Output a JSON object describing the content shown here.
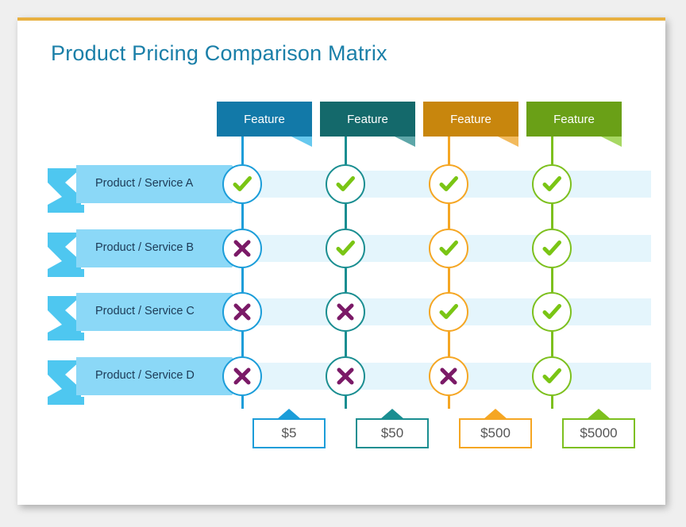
{
  "page": {
    "title": "Product Pricing Comparison Matrix",
    "accent_bar_color": "#e8b040",
    "card_background": "#ffffff",
    "canvas_background": "#efefef",
    "title_color": "#1a7fa8"
  },
  "palette": {
    "check_color": "#7ac514",
    "cross_color": "#7b1a67",
    "row_stripe": "#e4f5fc",
    "ribbon_body": "#8bd8f7",
    "ribbon_fold": "#4ec7f0",
    "ribbon_text": "#1c3a56",
    "price_text": "#555555"
  },
  "columns": [
    {
      "header": "Feature",
      "price": "$5",
      "header_color": "#1279a8",
      "accent_color": "#1b9dd9",
      "tail_color": "#2bb3e8"
    },
    {
      "header": "Feature",
      "price": "$50",
      "header_color": "#14696b",
      "accent_color": "#1a8e91",
      "tail_color": "#1f8487"
    },
    {
      "header": "Feature",
      "price": "$500",
      "header_color": "#c8860d",
      "accent_color": "#f5a623",
      "tail_color": "#eda01f"
    },
    {
      "header": "Feature",
      "price": "$5000",
      "header_color": "#6aa017",
      "accent_color": "#7dc01e",
      "tail_color": "#85c927"
    }
  ],
  "rows": [
    {
      "label": "Product / Service A",
      "values": [
        "check",
        "check",
        "check",
        "check"
      ]
    },
    {
      "label": "Product / Service B",
      "values": [
        "cross",
        "check",
        "check",
        "check"
      ]
    },
    {
      "label": "Product / Service C",
      "values": [
        "cross",
        "cross",
        "check",
        "check"
      ]
    },
    {
      "label": "Product / Service D",
      "values": [
        "cross",
        "cross",
        "cross",
        "check"
      ]
    }
  ],
  "icons": {
    "check": "check-mark-icon",
    "cross": "cross-mark-icon"
  }
}
